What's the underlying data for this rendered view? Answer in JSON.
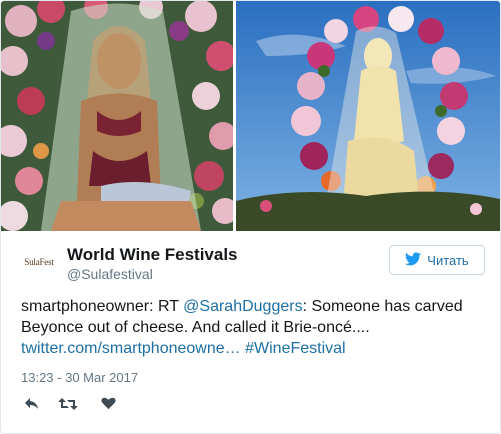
{
  "tweet": {
    "author": {
      "logo_text": "SulaFest",
      "display_name": "World Wine Festivals",
      "handle": "@Sulafestival"
    },
    "follow_button": {
      "label": "Читать"
    },
    "text": {
      "prefix": "smartphoneowner: RT ",
      "mention": "@SarahDuggers",
      "body": ": Someone has carved Beyonce out of cheese. And called it Brie-oncé....",
      "url": "twitter.com/smartphoneowne…",
      "hashtag": "#WineFestival"
    },
    "timestamp": "13:23 - 30 Mar 2017",
    "actions": [
      {
        "name": "reply",
        "icon": "reply-icon"
      },
      {
        "name": "retweet",
        "icon": "retweet-icon"
      },
      {
        "name": "like",
        "icon": "heart-icon"
      }
    ],
    "colors": {
      "link": "#1d6fa5",
      "muted": "#657786",
      "border": "#e1e8ed",
      "action_icon": "#3e4a54"
    }
  }
}
